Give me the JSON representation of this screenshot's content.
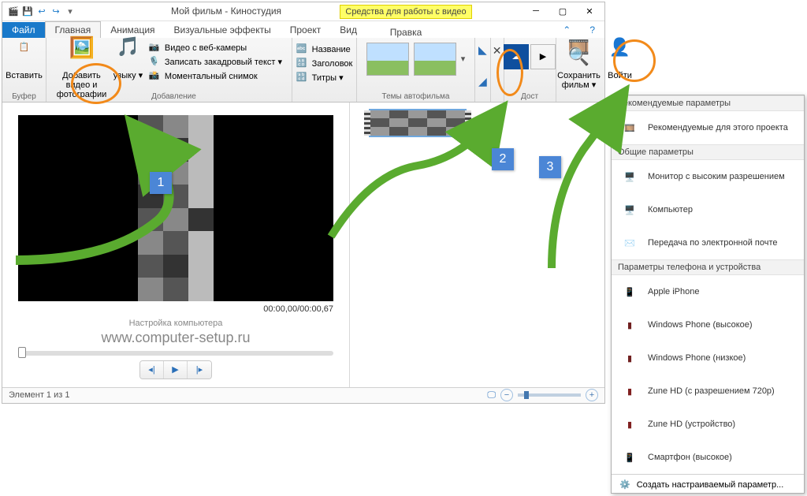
{
  "title": "Мой фильм - Киностудия",
  "contextual_tools": "Средства для работы с видео",
  "tabs": {
    "file": "Файл",
    "home": "Главная",
    "animation": "Анимация",
    "effects": "Визуальные эффекты",
    "project": "Проект",
    "view": "Вид",
    "editing": "Правка"
  },
  "ribbon": {
    "paste": "Вставить",
    "clipboard": "Буфер",
    "add_video": "Добавить видео и фотографии",
    "add_music": "Добавить музыку ▾",
    "music_label": "узыку ▾",
    "webcam": "Видео с веб-камеры",
    "narration": "Записать закадровый текст ▾",
    "snapshot": "Моментальный снимок",
    "adding": "Добавление",
    "btn_title": "Название",
    "btn_caption": "Заголовок",
    "btn_credits": "Титры ▾",
    "themes": "Темы автофильма",
    "save_movie": "Сохранить фильм ▾",
    "signin": "Войти",
    "share": "Дост"
  },
  "preview": {
    "timecode": "00:00,00/00:00,67",
    "watermark_line1": "Настройка компьютера",
    "watermark_line2": "www.computer-setup.ru"
  },
  "status": {
    "text": "Элемент 1 из 1"
  },
  "dropdown": {
    "hdr_recommended": "Рекомендуемые параметры",
    "rec_project": "Рекомендуемые для этого проекта",
    "hdr_common": "Общие параметры",
    "high_res": "Монитор с высоким разрешением",
    "computer": "Компьютер",
    "email": "Передача по электронной почте",
    "hdr_phone": "Параметры телефона и устройства",
    "iphone": "Apple iPhone",
    "wp_high": "Windows Phone (высокое)",
    "wp_low": "Windows Phone (низкое)",
    "zune720": "Zune HD (с разрешением 720p)",
    "zune": "Zune HD (устройство)",
    "smartphone": "Смартфон (высокое)",
    "custom": "Создать настраиваемый параметр..."
  },
  "annot": {
    "n1": "1",
    "n2": "2",
    "n3": "3"
  }
}
